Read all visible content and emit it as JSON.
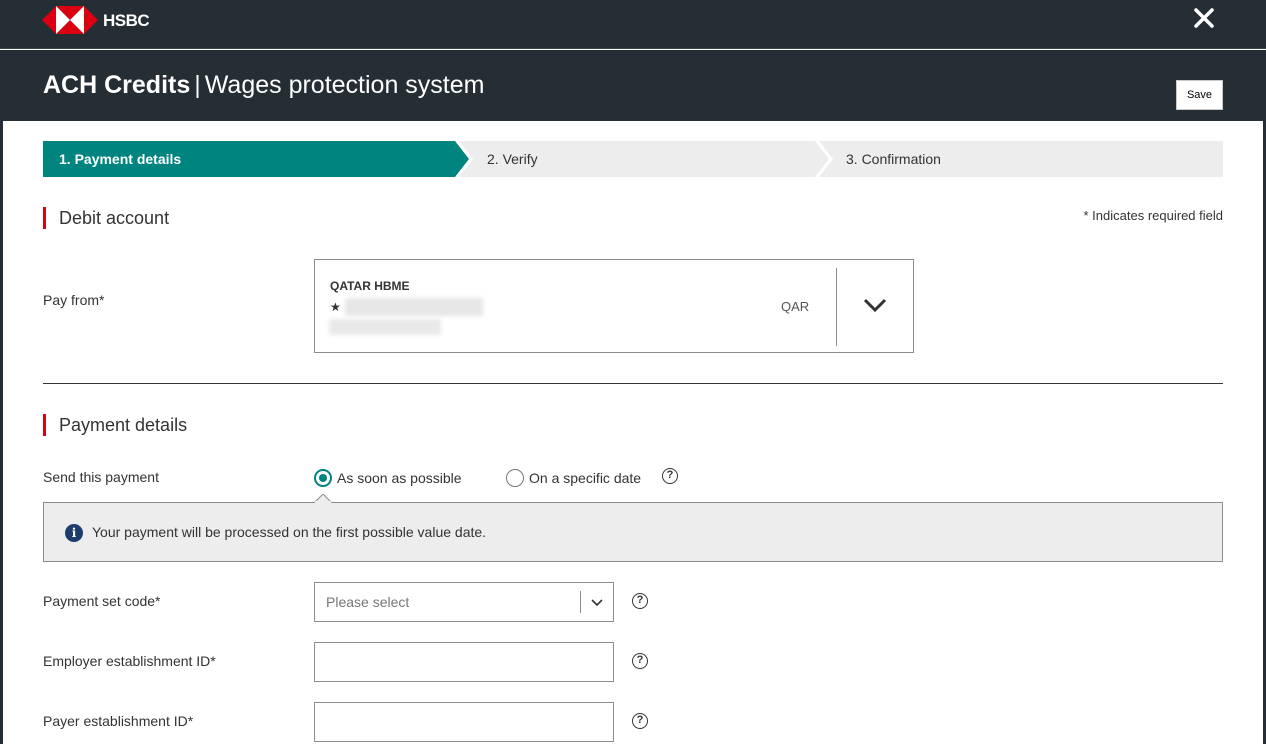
{
  "brand": {
    "name": "HSBC"
  },
  "header": {
    "title_main": "ACH Credits",
    "separator": "|",
    "title_sub": "Wages protection system",
    "save_label": "Save"
  },
  "stepper": {
    "steps": [
      {
        "label": "1. Payment details",
        "state": "active"
      },
      {
        "label": "2. Verify",
        "state": "pending"
      },
      {
        "label": "3. Confirmation",
        "state": "pending"
      }
    ],
    "active_color": "#00847f",
    "pending_color": "#ededed"
  },
  "debit_account": {
    "heading": "Debit account",
    "required_note": "* Indicates required field",
    "pay_from_label": "Pay from*",
    "account_name": "QATAR HBME",
    "favourite_star": "★",
    "currency": "QAR"
  },
  "payment_details": {
    "heading": "Payment details",
    "send_label": "Send this payment",
    "options": [
      {
        "label": "As soon as possible",
        "checked": true
      },
      {
        "label": "On a specific date",
        "checked": false
      }
    ],
    "info_message": "Your payment will be processed on the first possible value date.",
    "payment_set_code_label": "Payment set code*",
    "payment_set_code_placeholder": "Please select",
    "employer_id_label": "Employer establishment ID*",
    "payer_id_label": "Payer establishment ID*",
    "employer_id_value": "",
    "payer_id_value": ""
  },
  "colors": {
    "header_bg": "#252e35",
    "accent_red": "#db0011",
    "teal": "#00847f",
    "info_icon": "#1f3d6c"
  }
}
